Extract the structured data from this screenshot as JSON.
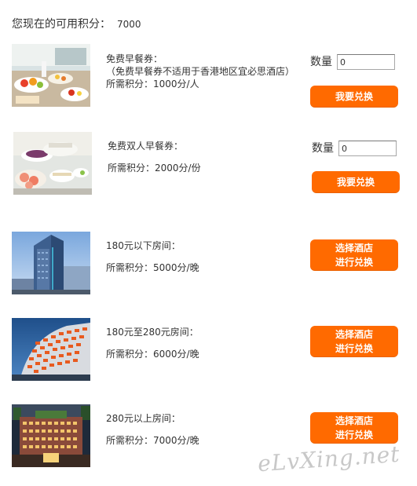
{
  "header": {
    "label": "您现在的可用积分：",
    "points": "7000"
  },
  "accent_color": "#ff6a00",
  "items": [
    {
      "title": "免费早餐券：",
      "note": "（免费早餐券不适用于香港地区宜必思酒店）",
      "cost": "所需积分：1000分/人",
      "qty_label": "数量",
      "qty_value": "0",
      "button": "我要兑换",
      "image": "breakfast-buffet-image"
    },
    {
      "title": "免费双人早餐券：",
      "note": "",
      "cost": "所需积分：2000分/份",
      "qty_label": "数量",
      "qty_value": "0",
      "button": "我要兑换",
      "image": "breakfast-buffet-image"
    },
    {
      "title": "180元以下房间：",
      "cost": "所需积分：5000分/晚",
      "button_line1": "选择酒店",
      "button_line2": "进行兑换",
      "image": "hotel-tower-image"
    },
    {
      "title": "180元至280元房间：",
      "cost": "所需积分：6000分/晚",
      "button_line1": "选择酒店",
      "button_line2": "进行兑换",
      "image": "hotel-facade-image"
    },
    {
      "title": "280元以上房间：",
      "cost": "所需积分：7000分/晚",
      "button_line1": "选择酒店",
      "button_line2": "进行兑换",
      "image": "hotel-night-image"
    }
  ],
  "watermark": "eLvXing.net"
}
